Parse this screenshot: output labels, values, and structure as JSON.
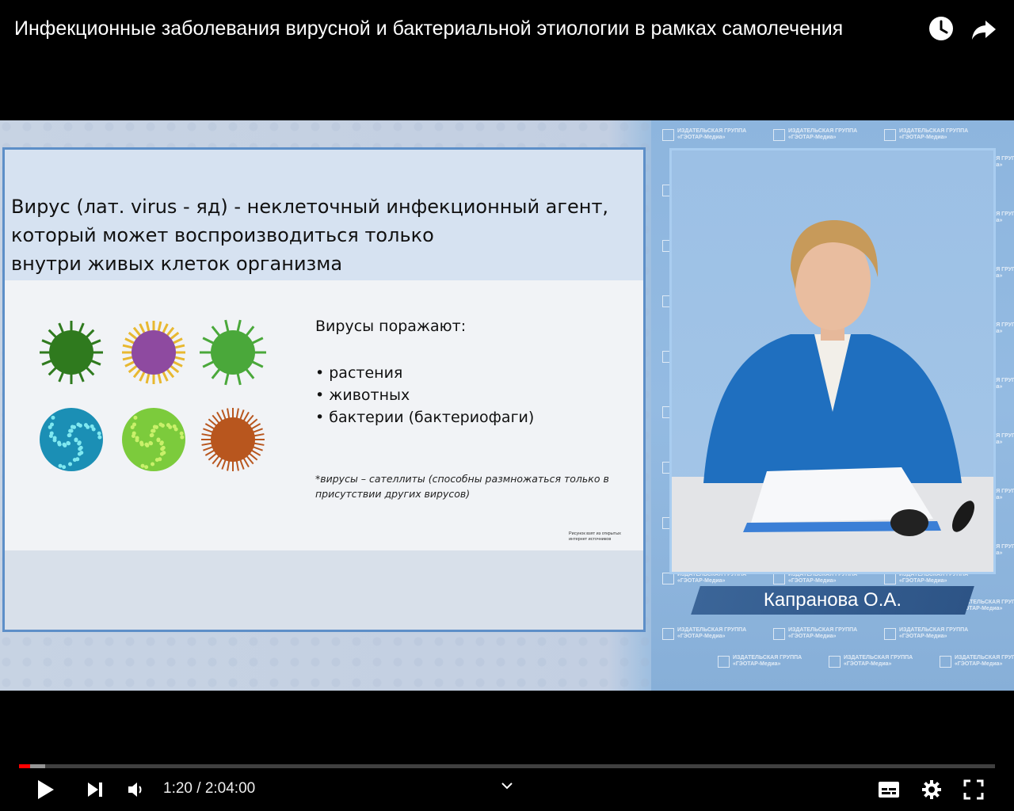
{
  "header": {
    "title": "Инфекционные заболевания вирусной и бактериальной этиологии в рамках самолечения",
    "watch_later_icon": "clock-icon",
    "share_icon": "share-arrow-icon"
  },
  "slide": {
    "heading_lines": [
      "Вирус (лат. virus - яд) - неклеточный инфекционный агент,",
      "который может воспроизводиться только",
      "внутри живых клеток организма"
    ],
    "affects_title": "Вирусы поражают:",
    "affects_items": [
      "растения",
      "животных",
      "бактерии (бактериофаги)"
    ],
    "note": "*вирусы – сателлиты (способны размножаться только в присутствии других вирусов)",
    "credit": "Рисунок взят из открытых интернет источников",
    "virus_colors": [
      "#2f7a1e",
      "#8e4aa0",
      "#4aa83a",
      "#1b8fb5",
      "#7ccb3c",
      "#b8561e"
    ]
  },
  "speaker": {
    "name": "Капранова О.А."
  },
  "watermark": {
    "line1": "ИЗДАТЕЛЬСКАЯ ГРУППА",
    "line2": "«ГЭОТАР-Медиа»"
  },
  "player": {
    "current_time": "1:20",
    "separator": " / ",
    "duration": "2:04:00",
    "played_fraction": 0.011,
    "buffered_fraction": 0.027,
    "accent": "#ff0000",
    "icons": [
      "play-icon",
      "next-icon",
      "volume-icon",
      "chevron-down-icon",
      "subtitles-icon",
      "settings-gear-icon",
      "fullscreen-icon"
    ]
  }
}
